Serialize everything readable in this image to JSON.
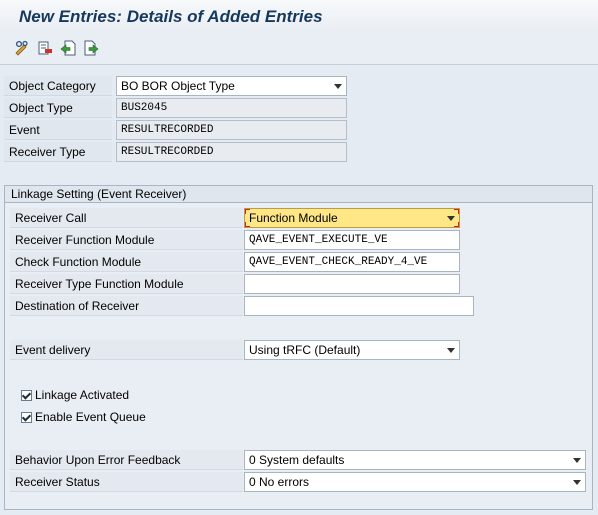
{
  "window": {
    "title": "New Entries: Details of Added Entries"
  },
  "toolbar": {
    "buttons": [
      {
        "icon": "edit-glasses-icon"
      },
      {
        "icon": "delete-entry-icon"
      },
      {
        "icon": "previous-entry-icon"
      },
      {
        "icon": "next-entry-icon"
      }
    ]
  },
  "header": {
    "object_category": {
      "label": "Object Category",
      "value": "BO BOR Object Type"
    },
    "object_type": {
      "label": "Object Type",
      "value": "BUS2045"
    },
    "event": {
      "label": "Event",
      "value": "RESULTRECORDED"
    },
    "receiver_type": {
      "label": "Receiver Type",
      "value": "RESULTRECORDED"
    }
  },
  "linkage": {
    "title": "Linkage Setting (Event Receiver)",
    "receiver_call": {
      "label": "Receiver Call",
      "value": "Function Module"
    },
    "receiver_function_module": {
      "label": "Receiver Function Module",
      "value": "QAVE_EVENT_EXECUTE_VE"
    },
    "check_function_module": {
      "label": "Check Function Module",
      "value": "QAVE_EVENT_CHECK_READY_4_VE"
    },
    "receiver_type_function_module": {
      "label": "Receiver Type Function Module",
      "value": ""
    },
    "destination_of_receiver": {
      "label": "Destination of Receiver",
      "value": ""
    },
    "event_delivery": {
      "label": "Event delivery",
      "value": "Using tRFC (Default)"
    },
    "linkage_activated": {
      "label": "Linkage Activated",
      "checked": true
    },
    "enable_event_queue": {
      "label": "Enable Event Queue",
      "checked": true
    },
    "behavior_on_error": {
      "label": "Behavior Upon Error Feedback",
      "value": "0 System defaults"
    },
    "receiver_status": {
      "label": "Receiver Status",
      "value": "0 No errors"
    }
  }
}
